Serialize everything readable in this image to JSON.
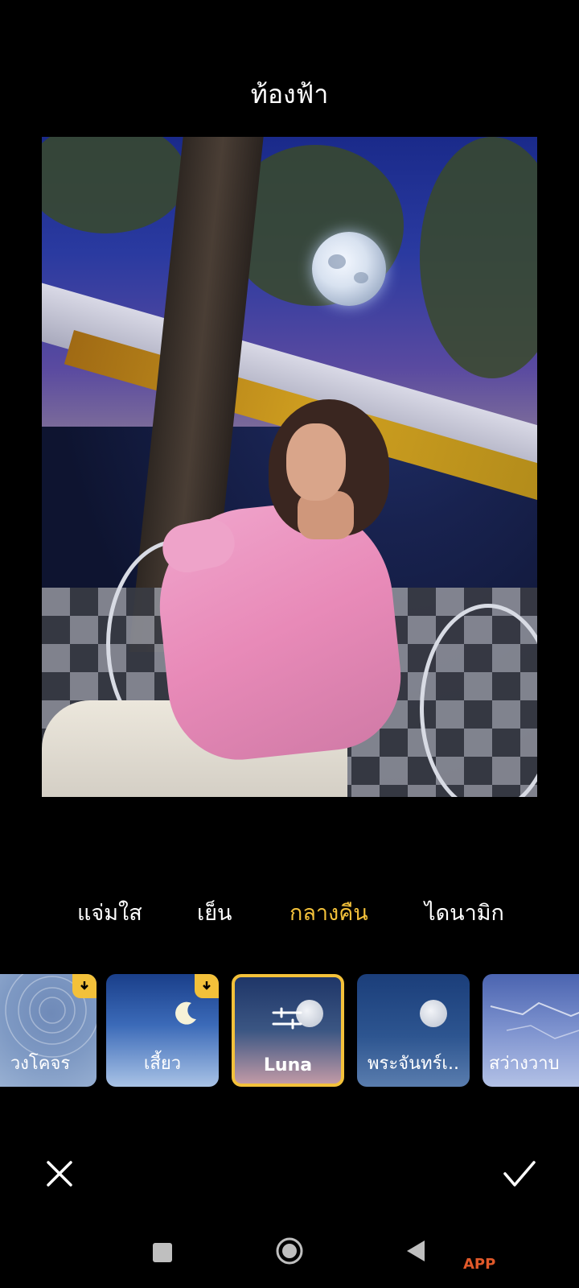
{
  "header": {
    "title": "ท้องฟ้า"
  },
  "tabs": [
    {
      "label": "แจ่มใส",
      "active": false
    },
    {
      "label": "เย็น",
      "active": false
    },
    {
      "label": "กลางคืน",
      "active": true
    },
    {
      "label": "ไดนามิก",
      "active": false
    }
  ],
  "sky_presets": [
    {
      "label": "วงโคจร",
      "downloadable": true,
      "selected": false
    },
    {
      "label": "เสี้ยว",
      "downloadable": true,
      "selected": false
    },
    {
      "label": "Luna",
      "downloadable": false,
      "selected": true
    },
    {
      "label": "พระจันทร์เ..",
      "downloadable": false,
      "selected": false
    },
    {
      "label": "สว่างวาบ",
      "downloadable": true,
      "selected": false
    }
  ],
  "actions": {
    "cancel_icon": "close-icon",
    "confirm_icon": "check-icon"
  },
  "system_nav": {
    "icons": [
      "recents-icon",
      "home-icon",
      "back-icon"
    ]
  },
  "watermark": "APP",
  "colors": {
    "accent": "#f3c13a",
    "background": "#000000"
  }
}
